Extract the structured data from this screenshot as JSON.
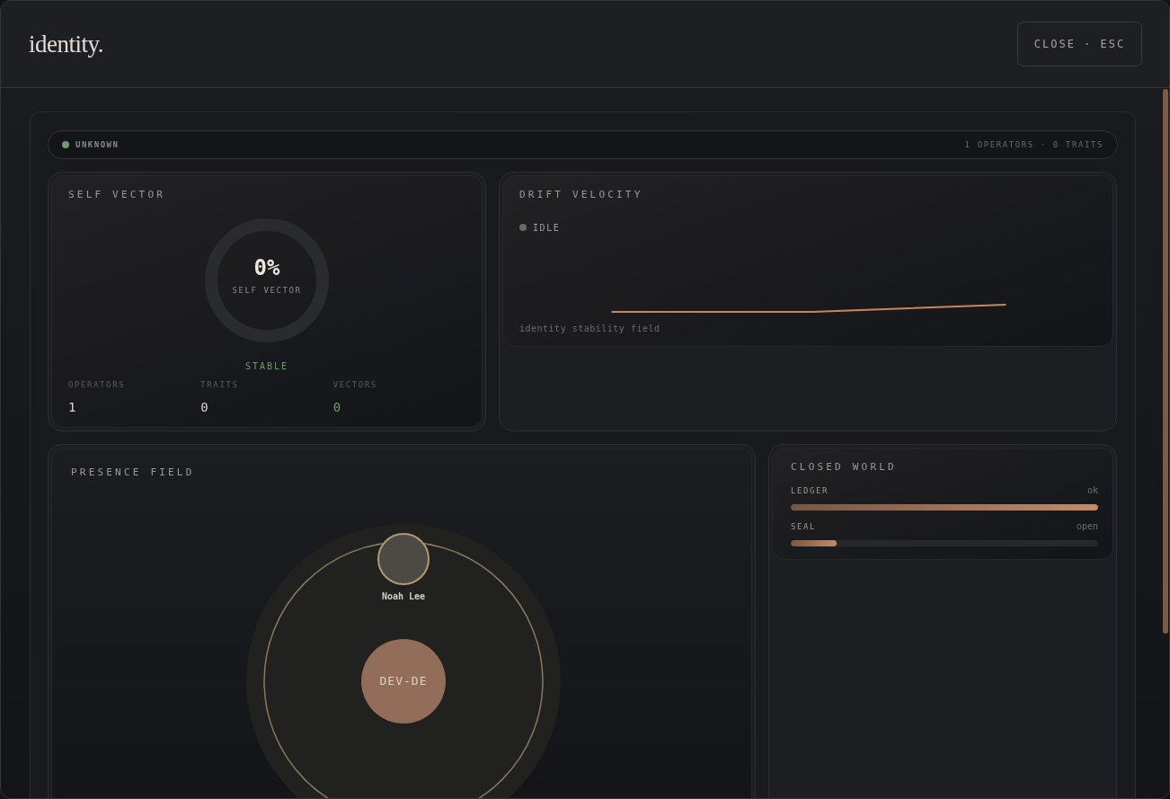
{
  "window": {
    "title": "identity.",
    "close_button": "CLOSE · ESC"
  },
  "status_bar": {
    "state": "UNKNOWN",
    "color": "#6f9a74",
    "summary": "1 OPERATORS · 0 TRAITS"
  },
  "self_vector": {
    "title": "SELF VECTOR",
    "percent": "0%",
    "ring_label": "SELF VECTOR",
    "status": "STABLE",
    "stats": [
      {
        "label": "OPERATORS",
        "value": "1",
        "kind": "plain"
      },
      {
        "label": "TRAITS",
        "value": "0",
        "kind": "plain"
      },
      {
        "label": "VECTORS",
        "value": "0",
        "kind": "accent"
      }
    ]
  },
  "drift_velocity": {
    "title": "DRIFT VELOCITY",
    "state": "IDLE",
    "color": "#6b6862",
    "caption": "identity stability field"
  },
  "presence_field": {
    "title": "PRESENCE FIELD",
    "operators": [
      {
        "name": "Noah Lee"
      }
    ],
    "center": "DEV-DE"
  },
  "closed_world": {
    "title": "CLOSED WORLD",
    "rows": [
      {
        "label": "LEDGER",
        "reading": "ok",
        "level": 1
      },
      {
        "label": "SEAL",
        "reading": "open",
        "level": 0.15
      }
    ]
  }
}
